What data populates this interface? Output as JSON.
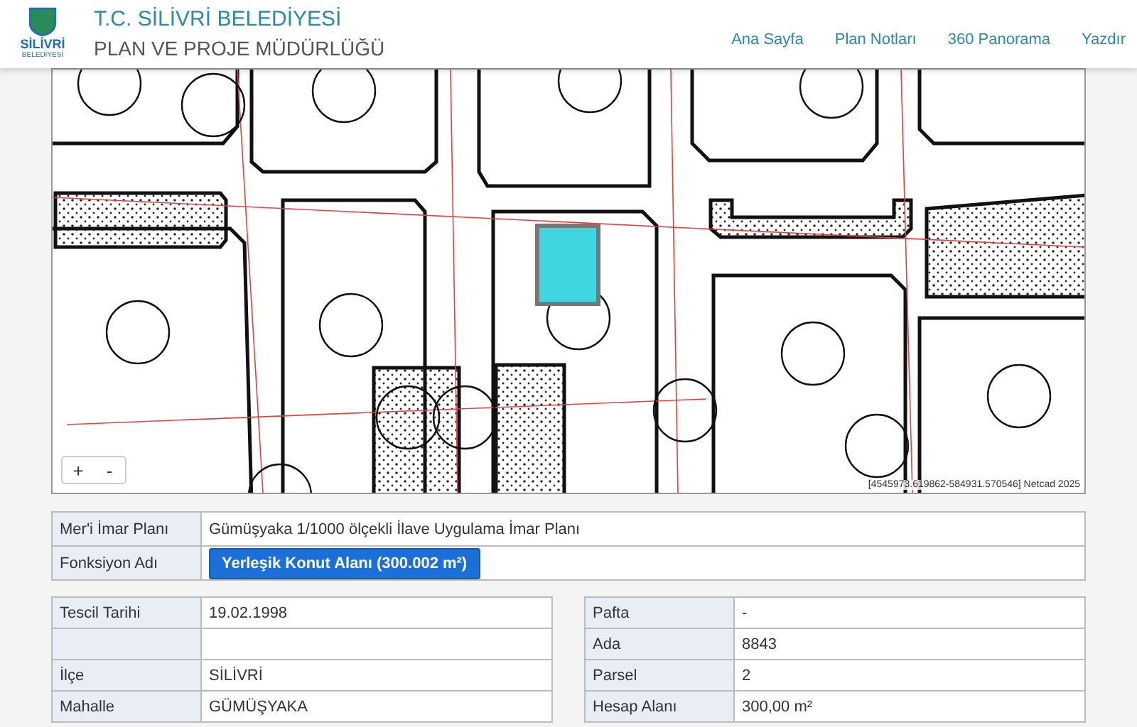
{
  "header": {
    "logo_text": "SİLİVRİ",
    "logo_subtext": "BELEDİYESİ",
    "title": "T.C. SİLİVRİ BELEDİYESİ",
    "subtitle": "PLAN VE PROJE MÜDÜRLÜĞÜ",
    "nav": [
      "Ana Sayfa",
      "Plan Notları",
      "360 Panorama",
      "Yazdır"
    ]
  },
  "map": {
    "zoom_in": "+",
    "zoom_out": "-",
    "coordinates": "[4545973.619862-584931.570546] Netcad 2025"
  },
  "plan_table": [
    {
      "label": "Mer'i İmar Planı",
      "value": "Gümüşyaka 1/1000 ölçekli İlave Uygulama İmar Planı",
      "kind": "text"
    },
    {
      "label": "Fonksiyon Adı",
      "value": "Yerleşik Konut Alanı (300.002 m²)",
      "kind": "button"
    }
  ],
  "left_table": [
    {
      "kind": "field",
      "label": "Tescil Tarihi",
      "value": "19.02.1998"
    },
    {
      "kind": "blank"
    },
    {
      "kind": "field",
      "label": "İlçe",
      "value": "SİLİVRİ"
    },
    {
      "kind": "field",
      "label": "Mahalle",
      "value": "GÜMÜŞYAKA"
    }
  ],
  "right_table": [
    {
      "kind": "field",
      "label": "Pafta",
      "value": "-"
    },
    {
      "kind": "field",
      "label": "Ada",
      "value": "8843"
    },
    {
      "kind": "field",
      "label": "Parsel",
      "value": "2"
    },
    {
      "kind": "field",
      "label": "Hesap Alanı",
      "value": "300,00 m²"
    }
  ]
}
